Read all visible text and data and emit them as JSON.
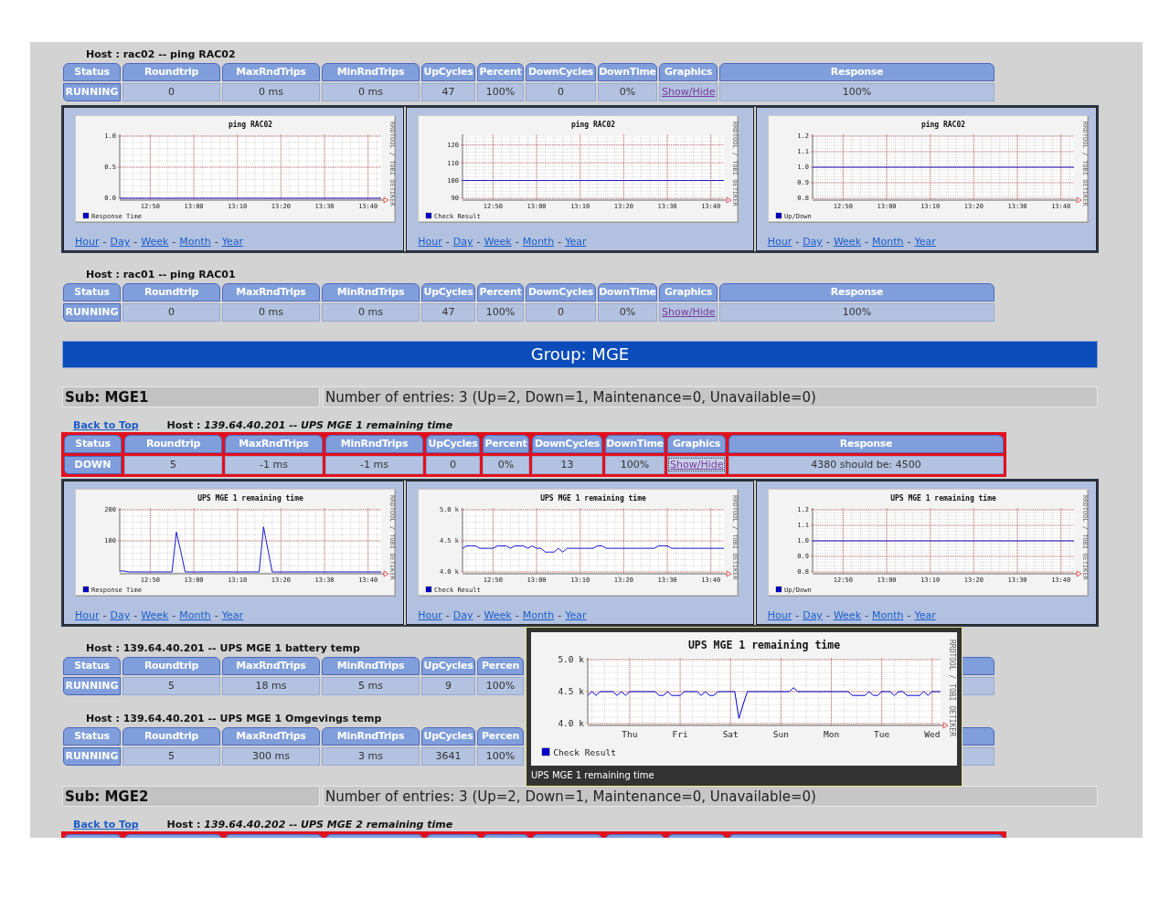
{
  "sections": [
    {
      "kind": "host",
      "title": "Host : rac02 -- ping RAC02",
      "alert": false,
      "columns": [
        "Status",
        "Roundtrip",
        "MaxRndTrips",
        "MinRndTrips",
        "UpCycles",
        "Percent",
        "DownCycles",
        "DownTime",
        "Graphics",
        "Response"
      ],
      "cells": [
        {
          "kind": "status",
          "text": "RUNNING"
        },
        {
          "kind": "value",
          "text": "0"
        },
        {
          "kind": "value",
          "text": "0 ms"
        },
        {
          "kind": "value",
          "text": "0 ms"
        },
        {
          "kind": "value",
          "text": "47"
        },
        {
          "kind": "value",
          "text": "100%"
        },
        {
          "kind": "value",
          "text": "0"
        },
        {
          "kind": "value",
          "text": "0%"
        },
        {
          "kind": "link",
          "text": "Show/Hide",
          "focused": false
        },
        {
          "kind": "value",
          "text": "100%"
        }
      ],
      "graphs": [
        {
          "credit": "RRDTOOL / TOBI OETIKER",
          "links": [
            "Hour",
            "Day",
            "Week",
            "Month",
            "Year"
          ],
          "link_separator": "-",
          "chart_data": {
            "type": "line",
            "title": "ping RAC02",
            "grid": true,
            "ylim": [
              0,
              1
            ],
            "yticks": [
              {
                "value": 0,
                "label": "0.0"
              },
              {
                "value": 0.5,
                "label": "0.5"
              },
              {
                "value": 1,
                "label": "1.0"
              }
            ],
            "categories": [
              null,
              null,
              null,
              null,
              null,
              null,
              null,
              "12:50",
              null,
              null,
              null,
              null,
              null,
              null,
              null,
              null,
              null,
              "13:00",
              null,
              null,
              null,
              null,
              null,
              null,
              null,
              null,
              null,
              "13:10",
              null,
              null,
              null,
              null,
              null,
              null,
              null,
              null,
              null,
              "13:20",
              null,
              null,
              null,
              null,
              null,
              null,
              null,
              null,
              null,
              "13:30",
              null,
              null,
              null,
              null,
              null,
              null,
              null,
              null,
              null,
              "13:40",
              null,
              null,
              null
            ],
            "series": [
              {
                "name": "Response Time",
                "color": "#0000cc",
                "values": [
                  0,
                  0,
                  0,
                  0,
                  0,
                  0,
                  0,
                  0,
                  0,
                  0,
                  0,
                  0,
                  0,
                  0,
                  0,
                  0,
                  0,
                  0,
                  0,
                  0,
                  0,
                  0,
                  0,
                  0,
                  0,
                  0,
                  0,
                  0,
                  0,
                  0,
                  0,
                  0,
                  0,
                  0,
                  0,
                  0,
                  0,
                  0,
                  0,
                  0,
                  0,
                  0,
                  0,
                  0,
                  0,
                  0,
                  0,
                  0,
                  0,
                  0,
                  0,
                  0,
                  0,
                  0,
                  0,
                  0,
                  0,
                  0,
                  0,
                  0,
                  0
                ]
              }
            ]
          }
        },
        {
          "credit": "RRDTOOL / TOBI OETIKER",
          "links": [
            "Hour",
            "Day",
            "Week",
            "Month",
            "Year"
          ],
          "link_separator": "-",
          "chart_data": {
            "type": "line",
            "title": "ping RAC02",
            "grid": true,
            "ylim": [
              90,
              125
            ],
            "yticks": [
              90,
              100,
              110,
              120
            ],
            "categories": [
              null,
              null,
              null,
              null,
              null,
              null,
              null,
              "12:50",
              null,
              null,
              null,
              null,
              null,
              null,
              null,
              null,
              null,
              "13:00",
              null,
              null,
              null,
              null,
              null,
              null,
              null,
              null,
              null,
              "13:10",
              null,
              null,
              null,
              null,
              null,
              null,
              null,
              null,
              null,
              "13:20",
              null,
              null,
              null,
              null,
              null,
              null,
              null,
              null,
              null,
              "13:30",
              null,
              null,
              null,
              null,
              null,
              null,
              null,
              null,
              null,
              "13:40",
              null,
              null,
              null
            ],
            "series": [
              {
                "name": "Check Result",
                "color": "#0000cc",
                "values": [
                  100,
                  100,
                  100,
                  100,
                  100,
                  100,
                  100,
                  100,
                  100,
                  100,
                  100,
                  100,
                  100,
                  100,
                  100,
                  100,
                  100,
                  100,
                  100,
                  100,
                  100,
                  100,
                  100,
                  100,
                  100,
                  100,
                  100,
                  100,
                  100,
                  100,
                  100,
                  100,
                  100,
                  100,
                  100,
                  100,
                  100,
                  100,
                  100,
                  100,
                  100,
                  100,
                  100,
                  100,
                  100,
                  100,
                  100,
                  100,
                  100,
                  100,
                  100,
                  100,
                  100,
                  100,
                  100,
                  100,
                  100,
                  100,
                  100,
                  100,
                  100
                ]
              }
            ]
          }
        },
        {
          "credit": "RRDTOOL / TOBI OETIKER",
          "links": [
            "Hour",
            "Day",
            "Week",
            "Month",
            "Year"
          ],
          "link_separator": "-",
          "chart_data": {
            "type": "line",
            "title": "ping RAC02",
            "grid": true,
            "ylim": [
              0.8,
              1.2
            ],
            "yticks": [
              {
                "value": 0.8,
                "label": "0.8"
              },
              {
                "value": 0.9,
                "label": "0.9"
              },
              {
                "value": 1,
                "label": "1.0"
              },
              {
                "value": 1.1,
                "label": "1.1"
              },
              {
                "value": 1.2,
                "label": "1.2"
              }
            ],
            "categories": [
              null,
              null,
              null,
              null,
              null,
              null,
              null,
              "12:50",
              null,
              null,
              null,
              null,
              null,
              null,
              null,
              null,
              null,
              "13:00",
              null,
              null,
              null,
              null,
              null,
              null,
              null,
              null,
              null,
              "13:10",
              null,
              null,
              null,
              null,
              null,
              null,
              null,
              null,
              null,
              "13:20",
              null,
              null,
              null,
              null,
              null,
              null,
              null,
              null,
              null,
              "13:30",
              null,
              null,
              null,
              null,
              null,
              null,
              null,
              null,
              null,
              "13:40",
              null,
              null,
              null
            ],
            "series": [
              {
                "name": "Up/Down",
                "color": "#0000cc",
                "values": [
                  1,
                  1,
                  1,
                  1,
                  1,
                  1,
                  1,
                  1,
                  1,
                  1,
                  1,
                  1,
                  1,
                  1,
                  1,
                  1,
                  1,
                  1,
                  1,
                  1,
                  1,
                  1,
                  1,
                  1,
                  1,
                  1,
                  1,
                  1,
                  1,
                  1,
                  1,
                  1,
                  1,
                  1,
                  1,
                  1,
                  1,
                  1,
                  1,
                  1,
                  1,
                  1,
                  1,
                  1,
                  1,
                  1,
                  1,
                  1,
                  1,
                  1,
                  1,
                  1,
                  1,
                  1,
                  1,
                  1,
                  1,
                  1,
                  1,
                  1,
                  1
                ]
              }
            ]
          }
        }
      ]
    },
    {
      "kind": "host",
      "title": "Host : rac01 -- ping RAC01",
      "alert": false,
      "columns": [
        "Status",
        "Roundtrip",
        "MaxRndTrips",
        "MinRndTrips",
        "UpCycles",
        "Percent",
        "DownCycles",
        "DownTime",
        "Graphics",
        "Response"
      ],
      "cells": [
        {
          "kind": "status",
          "text": "RUNNING"
        },
        {
          "kind": "value",
          "text": "0"
        },
        {
          "kind": "value",
          "text": "0 ms"
        },
        {
          "kind": "value",
          "text": "0 ms"
        },
        {
          "kind": "value",
          "text": "47"
        },
        {
          "kind": "value",
          "text": "100%"
        },
        {
          "kind": "value",
          "text": "0"
        },
        {
          "kind": "value",
          "text": "0%"
        },
        {
          "kind": "link",
          "text": "Show/Hide",
          "focused": false
        },
        {
          "kind": "value",
          "text": "100%"
        }
      ]
    },
    {
      "kind": "group",
      "label": "Group: MGE"
    },
    {
      "kind": "sub",
      "name": "Sub: MGE1",
      "summary": "Number of entries: 3 (Up=2, Down=1, Maintenance=0, Unavailable=0)"
    },
    {
      "kind": "host",
      "back_link": "Back to Top",
      "title": "Host : *139.64.40.201 -- UPS MGE 1 remaining time*",
      "alert": true,
      "columns": [
        "Status",
        "Roundtrip",
        "MaxRndTrips",
        "MinRndTrips",
        "UpCycles",
        "Percent",
        "DownCycles",
        "DownTime",
        "Graphics",
        "Response"
      ],
      "cells": [
        {
          "kind": "status",
          "text": "DOWN"
        },
        {
          "kind": "value",
          "text": "5"
        },
        {
          "kind": "value",
          "text": "-1 ms"
        },
        {
          "kind": "value",
          "text": "-1 ms"
        },
        {
          "kind": "value",
          "text": "0"
        },
        {
          "kind": "value",
          "text": "0%"
        },
        {
          "kind": "value",
          "text": "13"
        },
        {
          "kind": "value",
          "text": "100%"
        },
        {
          "kind": "link",
          "text": "Show/Hide",
          "focused": true
        },
        {
          "kind": "value",
          "text": "4380 should be: 4500"
        }
      ],
      "graphs": [
        {
          "credit": "RRDTOOL / TOBI OETIKER",
          "links": [
            "Hour",
            "Day",
            "Week",
            "Month",
            "Year"
          ],
          "link_separator": "-",
          "chart_data": {
            "type": "line",
            "title": "UPS MGE 1 remaining time",
            "grid": true,
            "ylim": [
              0,
              200
            ],
            "yticks": [
              100,
              200
            ],
            "categories": [
              null,
              null,
              null,
              null,
              null,
              null,
              null,
              "12:50",
              null,
              null,
              null,
              null,
              null,
              null,
              null,
              null,
              null,
              "13:00",
              null,
              null,
              null,
              null,
              null,
              null,
              null,
              null,
              null,
              "13:10",
              null,
              null,
              null,
              null,
              null,
              null,
              null,
              null,
              null,
              "13:20",
              null,
              null,
              null,
              null,
              null,
              null,
              null,
              null,
              null,
              "13:30",
              null,
              null,
              null,
              null,
              null,
              null,
              null,
              null,
              null,
              "13:40",
              null,
              null,
              null
            ],
            "series": [
              {
                "name": "Response Time",
                "color": "#0000cc",
                "values": [
                  3,
                  3,
                  0,
                  0,
                  0,
                  0,
                  0,
                  0,
                  0,
                  0,
                  0,
                  0,
                  0,
                  128,
                  67,
                  0,
                  0,
                  0,
                  0,
                  0,
                  0,
                  0,
                  0,
                  0,
                  0,
                  0,
                  0,
                  0,
                  0,
                  0,
                  0,
                  0,
                  0,
                  145,
                  72,
                  0,
                  0,
                  0,
                  0,
                  0,
                  0,
                  0,
                  0,
                  0,
                  0,
                  0,
                  0,
                  0,
                  0,
                  0,
                  0,
                  0,
                  0,
                  0,
                  0,
                  0,
                  0,
                  0,
                  0,
                  0,
                  0
                ]
              }
            ]
          }
        },
        {
          "credit": "RRDTOOL / TOBI OETIKER",
          "links": [
            "Hour",
            "Day",
            "Week",
            "Month",
            "Year"
          ],
          "link_separator": "-",
          "chart_data": {
            "type": "line",
            "title": "UPS MGE 1 remaining time",
            "grid": true,
            "ylim": [
              4000,
              5000
            ],
            "yticks": [
              {
                "value": 4000,
                "label": "4.0 k"
              },
              {
                "value": 4500,
                "label": "4.5 k"
              },
              {
                "value": 5000,
                "label": "5.0 k"
              }
            ],
            "categories": [
              null,
              null,
              null,
              null,
              null,
              null,
              null,
              "12:50",
              null,
              null,
              null,
              null,
              null,
              null,
              null,
              null,
              null,
              "13:00",
              null,
              null,
              null,
              null,
              null,
              null,
              null,
              null,
              null,
              "13:10",
              null,
              null,
              null,
              null,
              null,
              null,
              null,
              null,
              null,
              "13:20",
              null,
              null,
              null,
              null,
              null,
              null,
              null,
              null,
              null,
              "13:30",
              null,
              null,
              null,
              null,
              null,
              null,
              null,
              null,
              null,
              "13:40",
              null,
              null,
              null
            ],
            "series": [
              {
                "name": "Check Result",
                "color": "#0000cc",
                "values": [
                  4380,
                  4420,
                  4420,
                  4420,
                  4380,
                  4380,
                  4380,
                  4380,
                  4420,
                  4420,
                  4420,
                  4380,
                  4420,
                  4420,
                  4420,
                  4380,
                  4420,
                  4380,
                  4380,
                  4320,
                  4320,
                  4320,
                  4380,
                  4320,
                  4380,
                  4380,
                  4380,
                  4380,
                  4380,
                  4380,
                  4380,
                  4420,
                  4420,
                  4380,
                  4380,
                  4380,
                  4380,
                  4380,
                  4380,
                  4380,
                  4380,
                  4380,
                  4380,
                  4380,
                  4380,
                  4420,
                  4420,
                  4420,
                  4380,
                  4380,
                  4380,
                  4380,
                  4380,
                  4380,
                  4380,
                  4380,
                  4380,
                  4380,
                  4380,
                  4380,
                  4380
                ]
              }
            ]
          }
        },
        {
          "credit": "RRDTOOL / TOBI OETIKER",
          "links": [
            "Hour",
            "Day",
            "Week",
            "Month",
            "Year"
          ],
          "link_separator": "-",
          "chart_data": {
            "type": "line",
            "title": "UPS MGE 1 remaining time",
            "grid": true,
            "ylim": [
              0.8,
              1.2
            ],
            "yticks": [
              {
                "value": 0.8,
                "label": "0.8"
              },
              {
                "value": 0.9,
                "label": "0.9"
              },
              {
                "value": 1,
                "label": "1.0"
              },
              {
                "value": 1.1,
                "label": "1.1"
              },
              {
                "value": 1.2,
                "label": "1.2"
              }
            ],
            "categories": [
              null,
              null,
              null,
              null,
              null,
              null,
              null,
              "12:50",
              null,
              null,
              null,
              null,
              null,
              null,
              null,
              null,
              null,
              "13:00",
              null,
              null,
              null,
              null,
              null,
              null,
              null,
              null,
              null,
              "13:10",
              null,
              null,
              null,
              null,
              null,
              null,
              null,
              null,
              null,
              "13:20",
              null,
              null,
              null,
              null,
              null,
              null,
              null,
              null,
              null,
              "13:30",
              null,
              null,
              null,
              null,
              null,
              null,
              null,
              null,
              null,
              "13:40",
              null,
              null,
              null
            ],
            "series": [
              {
                "name": "Up/Down",
                "color": "#0000cc",
                "values": [
                  1,
                  1,
                  1,
                  1,
                  1,
                  1,
                  1,
                  1,
                  1,
                  1,
                  1,
                  1,
                  1,
                  1,
                  1,
                  1,
                  1,
                  1,
                  1,
                  1,
                  1,
                  1,
                  1,
                  1,
                  1,
                  1,
                  1,
                  1,
                  1,
                  1,
                  1,
                  1,
                  1,
                  1,
                  1,
                  1,
                  1,
                  1,
                  1,
                  1,
                  1,
                  1,
                  1,
                  1,
                  1,
                  1,
                  1,
                  1,
                  1,
                  1,
                  1,
                  1,
                  1,
                  1,
                  1,
                  1,
                  1,
                  1,
                  1,
                  1,
                  1
                ]
              }
            ]
          }
        }
      ]
    },
    {
      "kind": "host",
      "title": "Host : 139.64.40.201 -- UPS MGE 1 battery temp",
      "alert": false,
      "columns": [
        "Status",
        "Roundtrip",
        "MaxRndTrips",
        "MinRndTrips",
        "UpCycles",
        "Percen"
      ],
      "cells": [
        {
          "kind": "status",
          "text": "RUNNING"
        },
        {
          "kind": "value",
          "text": "5"
        },
        {
          "kind": "value",
          "text": "18 ms"
        },
        {
          "kind": "value",
          "text": "5 ms"
        },
        {
          "kind": "value",
          "text": "9"
        },
        {
          "kind": "value",
          "text": "100%"
        }
      ]
    },
    {
      "kind": "host",
      "title": "Host : 139.64.40.201 -- UPS MGE 1 Omgevings temp",
      "alert": false,
      "columns": [
        "Status",
        "Roundtrip",
        "MaxRndTrips",
        "MinRndTrips",
        "UpCycles",
        "Percen"
      ],
      "cells": [
        {
          "kind": "status",
          "text": "RUNNING"
        },
        {
          "kind": "value",
          "text": "5"
        },
        {
          "kind": "value",
          "text": "300 ms"
        },
        {
          "kind": "value",
          "text": "3 ms"
        },
        {
          "kind": "value",
          "text": "3641"
        },
        {
          "kind": "value",
          "text": "100%"
        }
      ]
    },
    {
      "kind": "sub",
      "name": "Sub: MGE2",
      "summary": "Number of entries: 3 (Up=2, Down=1, Maintenance=0, Unavailable=0)"
    },
    {
      "kind": "host",
      "back_link": "Back to Top",
      "title": "Host : *139.64.40.202 -- UPS MGE 2 remaining time*",
      "alert": true
    }
  ],
  "tooltip": {
    "caption": "UPS MGE 1 remaining time",
    "credit": "RRDTOOL / TOBI OETIKER",
    "chart_data": {
      "type": "line",
      "grid": true,
      "title": "UPS MGE 1 remaining time",
      "ylim": [
        4000,
        5000
      ],
      "yticks": [
        {
          "value": 4000,
          "label": "4.0 k"
        },
        {
          "value": 4500,
          "label": "4.5 k"
        },
        {
          "value": 5000,
          "label": "5.0 k"
        }
      ],
      "categories": [
        null,
        null,
        null,
        null,
        null,
        null,
        null,
        null,
        null,
        null,
        "Thu",
        null,
        null,
        null,
        null,
        null,
        null,
        null,
        null,
        null,
        null,
        null,
        "Fri",
        null,
        null,
        null,
        null,
        null,
        null,
        null,
        null,
        null,
        null,
        null,
        "Sat",
        null,
        null,
        null,
        null,
        null,
        null,
        null,
        null,
        null,
        null,
        null,
        "Sun",
        null,
        null,
        null,
        null,
        null,
        null,
        null,
        null,
        null,
        null,
        null,
        "Mon",
        null,
        null,
        null,
        null,
        null,
        null,
        null,
        null,
        null,
        null,
        null,
        "Tue",
        null,
        null,
        null,
        null,
        null,
        null,
        null,
        null,
        null,
        null,
        null,
        "Wed",
        null,
        null
      ],
      "series": [
        {
          "name": "Check Result",
          "color": "#0000cc",
          "values": [
            4440,
            4500,
            4440,
            4500,
            4500,
            4500,
            4500,
            4440,
            4500,
            4440,
            4500,
            4500,
            4500,
            4500,
            4500,
            4500,
            4500,
            4440,
            4440,
            4500,
            4440,
            4440,
            4440,
            4500,
            4500,
            4500,
            4500,
            4440,
            4500,
            4440,
            4440,
            4500,
            4500,
            4500,
            4500,
            4500,
            4080,
            4300,
            4500,
            4500,
            4500,
            4500,
            4500,
            4500,
            4500,
            4500,
            4500,
            4500,
            4500,
            4560,
            4500,
            4500,
            4500,
            4500,
            4500,
            4500,
            4500,
            4500,
            4500,
            4500,
            4500,
            4500,
            4500,
            4440,
            4440,
            4440,
            4440,
            4500,
            4440,
            4440,
            4500,
            4500,
            4500,
            4440,
            4500,
            4500,
            4440,
            4440,
            4440,
            4440,
            4500,
            4440,
            4500,
            4500,
            4500
          ]
        }
      ]
    }
  }
}
